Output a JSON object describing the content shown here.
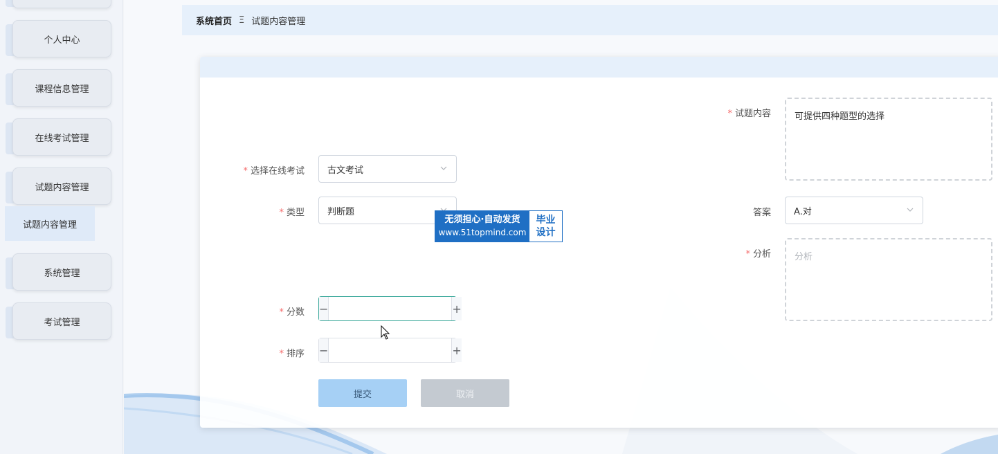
{
  "sidebar": {
    "items": [
      {
        "label": ""
      },
      {
        "label": "个人中心"
      },
      {
        "label": "课程信息管理"
      },
      {
        "label": "在线考试管理"
      },
      {
        "label": "试题内容管理"
      },
      {
        "label": "系统管理"
      },
      {
        "label": "考试管理"
      }
    ],
    "submenu_label": "试题内容管理"
  },
  "breadcrumb": {
    "home": "系统首页",
    "separator": "Ξ",
    "current": "试题内容管理"
  },
  "form": {
    "exam": {
      "label": "选择在线考试",
      "value": "古文考试"
    },
    "type": {
      "label": "类型",
      "value": "判断题"
    },
    "score": {
      "label": "分数",
      "minus": "−",
      "plus": "+"
    },
    "order": {
      "label": "排序",
      "minus": "−",
      "plus": "+"
    },
    "content": {
      "label": "试题内容",
      "value": "可提供四种题型的选择"
    },
    "answer": {
      "label": "答案",
      "value": "A.对"
    },
    "analysis": {
      "label": "分析",
      "placeholder": "分析"
    },
    "required_mark": "*",
    "submit": "提交",
    "cancel": "取消"
  },
  "watermark": {
    "line1": "无须担心·自动发货",
    "line2": "www.51topmind.com",
    "badge_line1": "毕业",
    "badge_line2": "设计"
  },
  "colors": {
    "accent": "#a6d0f5",
    "breadcrumb_bg": "#e6f0fb",
    "required": "#f56c6c",
    "watermark": "#1f6fc4"
  }
}
